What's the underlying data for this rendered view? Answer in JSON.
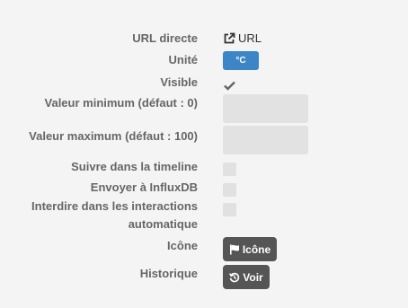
{
  "fields": {
    "url": {
      "label": "URL directe",
      "link_text": "URL",
      "icon": "external-link-icon"
    },
    "unit": {
      "label": "Unité",
      "value": "°C"
    },
    "visible": {
      "label": "Visible",
      "checked": true
    },
    "min": {
      "label": "Valeur minimum (défaut : 0)",
      "value": ""
    },
    "max": {
      "label": "Valeur maximum (défaut : 100)",
      "value": ""
    },
    "timeline": {
      "label": "Suivre dans la timeline",
      "checked": false
    },
    "influx": {
      "label": "Envoyer à InfluxDB",
      "checked": false
    },
    "interactions": {
      "label_line1": "Interdire dans les interactions",
      "label_line2": "automatique",
      "checked": false
    },
    "icon": {
      "label": "Icône",
      "button_label": "Icône",
      "button_icon": "flag-icon"
    },
    "history": {
      "label": "Historique",
      "button_label": "Voir",
      "button_icon": "history-icon"
    }
  },
  "colors": {
    "background": "#f4f4f4",
    "label": "#666666",
    "unit_button": "#3c85c6",
    "dark_button": "#555555",
    "input_bg": "#e2e2e2"
  }
}
